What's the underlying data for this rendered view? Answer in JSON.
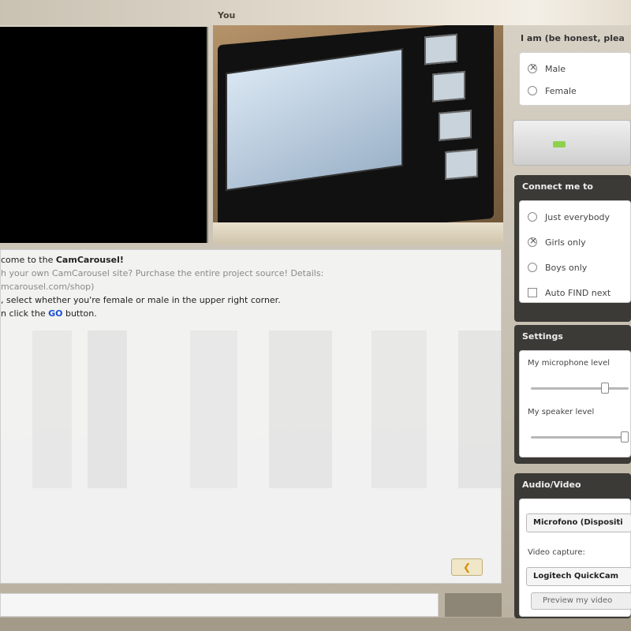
{
  "video": {
    "you_label": "You"
  },
  "chat": {
    "lines": [
      {
        "prefix": "come to the ",
        "bold": "CamCarousel!"
      },
      {
        "muted": "h your own CamCarousel site? Purchase the entire project source! Details:"
      },
      {
        "muted": "mcarousel.com/shop)"
      },
      {
        "text": ", select whether you're female or male in the upper right corner."
      },
      {
        "prefix": "n click the ",
        "go": "GO",
        "suffix": " button."
      }
    ],
    "send_icon": "arrow-icon"
  },
  "gender": {
    "title": "I am (be honest, plea",
    "options": [
      {
        "label": "Male",
        "checked": true
      },
      {
        "label": "Female",
        "checked": false
      }
    ]
  },
  "go_button": {
    "indicator_color": "#8fd14f"
  },
  "connect": {
    "title": "Connect me to",
    "options": [
      {
        "label": "Just everybody",
        "checked": false
      },
      {
        "label": "Girls only",
        "checked": true
      },
      {
        "label": "Boys only",
        "checked": false
      }
    ],
    "auto_find_label": "Auto FIND next"
  },
  "settings": {
    "title": "Settings",
    "mic_label": "My microphone level",
    "mic_level": 0.78,
    "speaker_label": "My speaker level",
    "speaker_level": 1.0
  },
  "av": {
    "title": "Audio/Video",
    "microphone_value": "Microfono (Dispositi",
    "video_capture_label": "Video capture:",
    "video_capture_value": "Logitech QuickCam",
    "preview_label": "Preview my video"
  }
}
